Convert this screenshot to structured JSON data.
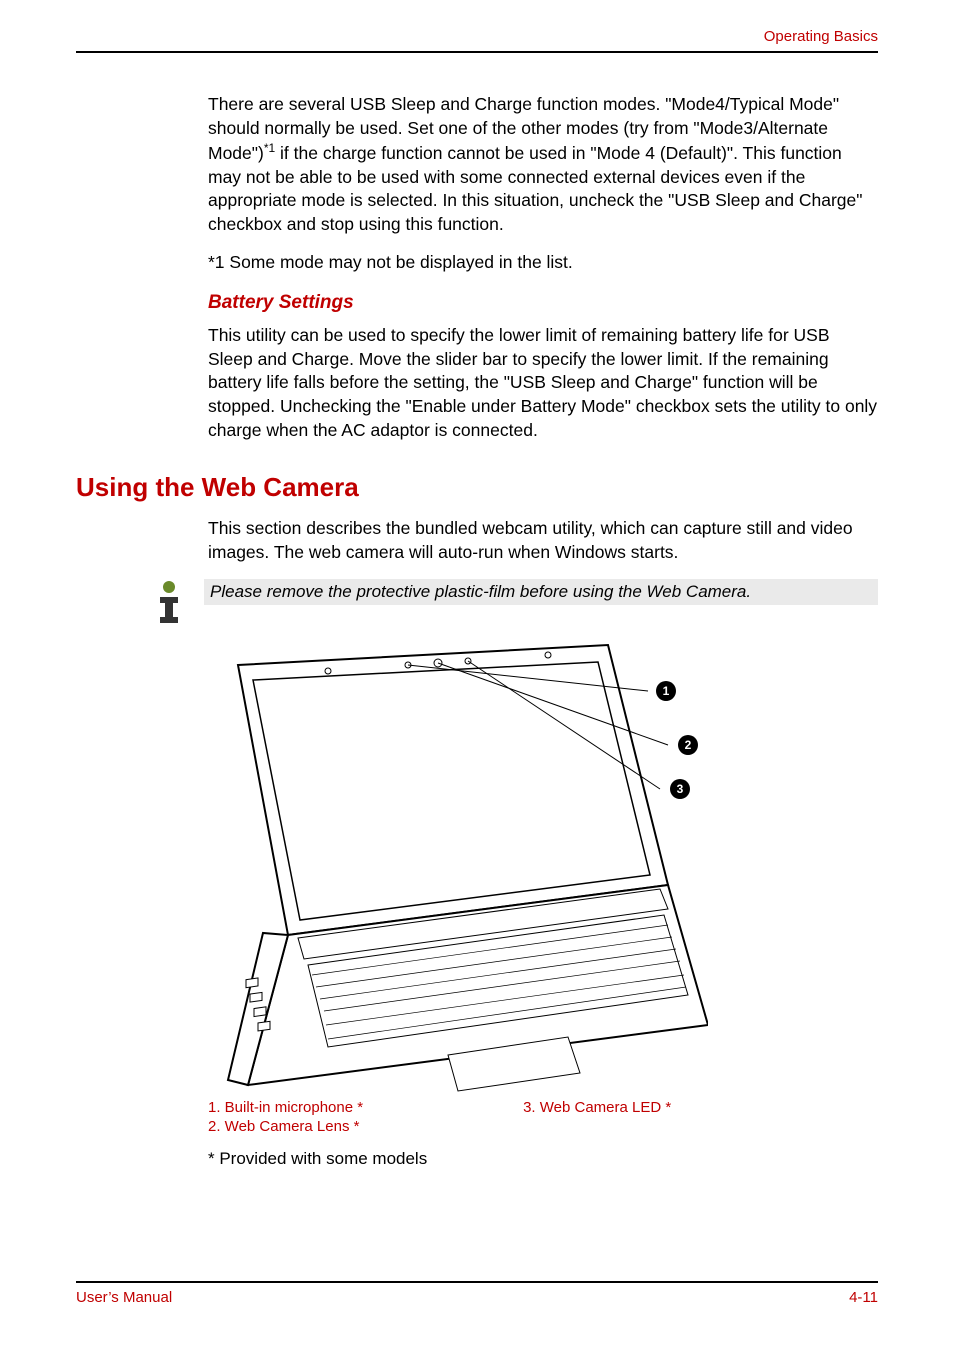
{
  "header": {
    "section_title": "Operating Basics"
  },
  "body": {
    "p1_a": "There are several USB Sleep and Charge function modes. \"Mode4/Typical Mode\" should normally be used. Set one of the other modes (try from \"Mode3/Alternate Mode\")",
    "p1_sup": "*1",
    "p1_b": " if the charge function cannot be used in \"Mode 4 (Default)\". This function may not be able to be used with some connected external devices even if the appropriate mode is selected. In this situation, uncheck the \"USB Sleep and Charge\" checkbox and stop using this function.",
    "p2": "*1 Some mode may not be displayed in the list.",
    "sub1": "Battery Settings",
    "p3": "This utility can be used to specify the lower limit of remaining battery life for USB Sleep and Charge. Move the slider bar to specify the lower limit. If the remaining battery life falls before the setting, the \"USB Sleep and Charge\" function will be stopped. Unchecking the \"Enable under Battery Mode\" checkbox sets the utility to only charge when the AC adaptor is connected.",
    "h1": "Using the Web Camera",
    "p4": "This section describes the bundled webcam utility, which can capture still and video images. The web camera will auto-run when Windows starts.",
    "note": "Please remove the protective plastic-film before using the Web Camera."
  },
  "figure": {
    "callouts": {
      "c1": "1",
      "c2": "2",
      "c3": "3"
    },
    "legend": {
      "l1": "1. Built-in microphone *",
      "l2": "2. Web Camera Lens *",
      "l3": "3. Web Camera LED *"
    },
    "asterisk": "* Provided with some models"
  },
  "footer": {
    "left": "User’s Manual",
    "right": "4-11"
  }
}
